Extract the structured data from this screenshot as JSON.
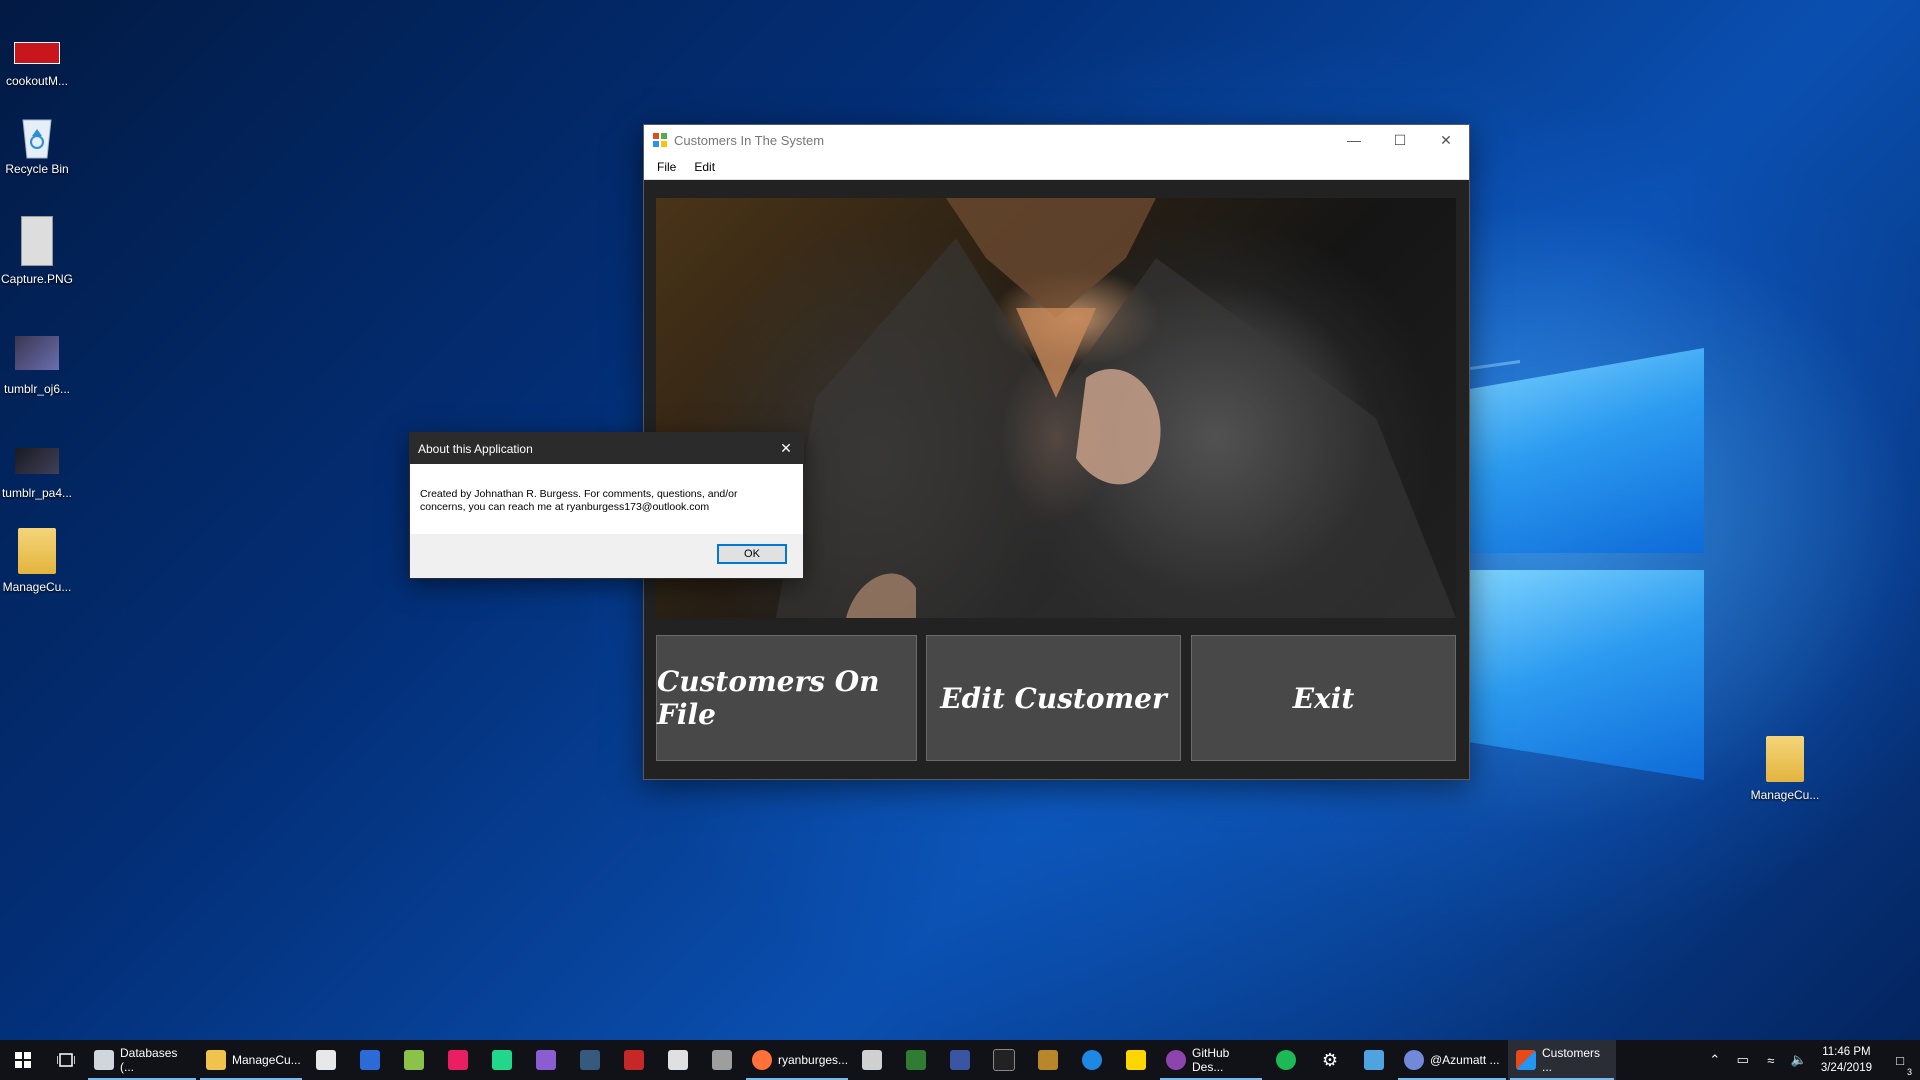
{
  "desktop": {
    "icons": [
      {
        "label": "cookoutM..."
      },
      {
        "label": "Recycle Bin"
      },
      {
        "label": "Capture.PNG"
      },
      {
        "label": "tumblr_oj6..."
      },
      {
        "label": "tumblr_pa4..."
      },
      {
        "label": "ManageCu..."
      }
    ],
    "right_icon": {
      "label": "ManageCu..."
    }
  },
  "main_window": {
    "title": "Customers In The System",
    "menu": [
      "File",
      "Edit"
    ],
    "buttons": {
      "customers_on_file": "Customers On File",
      "edit_customer": "Edit Customer",
      "exit": "Exit"
    }
  },
  "about_dialog": {
    "title": "About this Application",
    "line1": "Created by Johnathan R. Burgess. For comments, questions, and/or",
    "line2": "concerns, you can reach me at ryanburgess173@outlook.com",
    "ok": "OK"
  },
  "taskbar": {
    "apps": {
      "databases": "Databases (...",
      "managecu": "ManageCu...",
      "firefox": "ryanburges...",
      "github": "GitHub Des...",
      "discord": "@Azumatt ...",
      "customers": "Customers ..."
    },
    "clock": {
      "time": "11:46 PM",
      "date": "3/24/2019"
    },
    "notification_count": "3"
  },
  "colors": {
    "accent": "#0078d7",
    "button_bg": "#484848",
    "taskbar_bg": "#101218"
  }
}
